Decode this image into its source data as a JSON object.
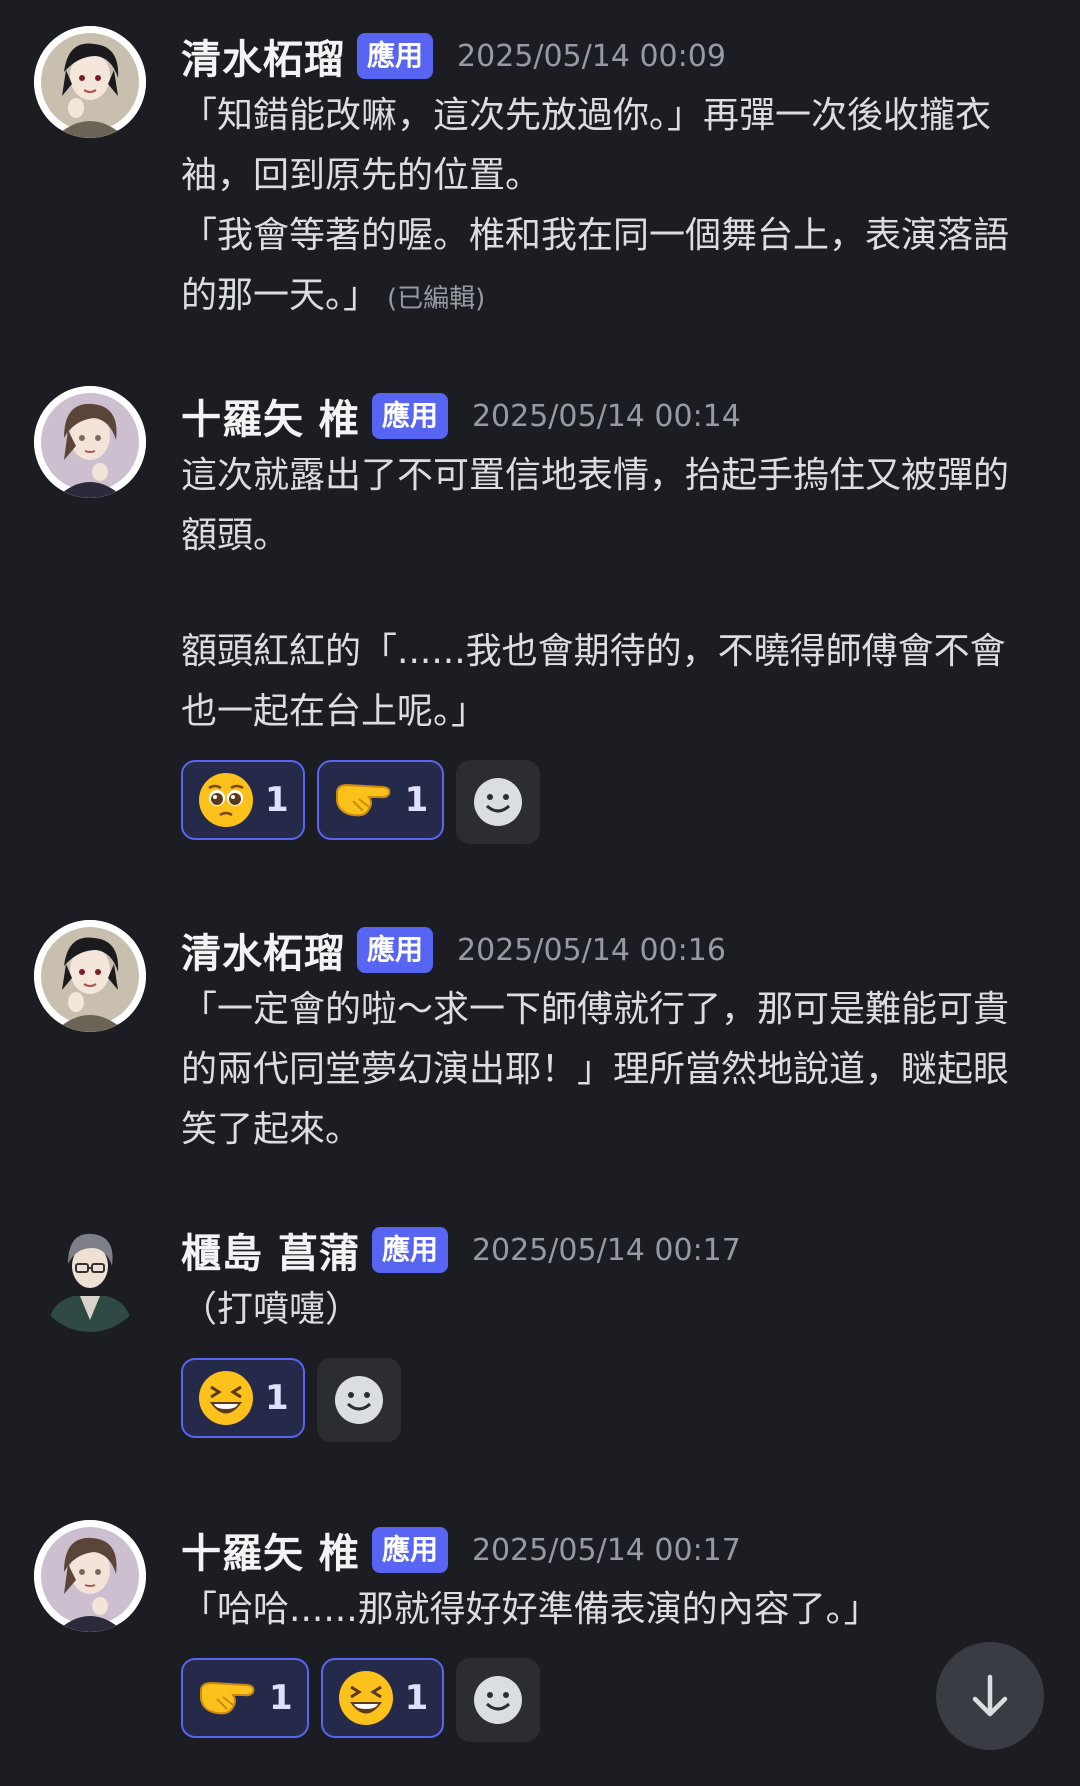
{
  "messages": [
    {
      "author": "清水柘瑠",
      "badge": "應用",
      "timestamp": "2025/05/14 00:09",
      "lines": [
        "「知錯能改嘛，這次先放過你。」再彈一次後收攏衣",
        "袖，回到原先的位置。",
        "「我會等著的喔。椎和我在同一個舞台上，表演落語",
        "的那一天。」"
      ],
      "edited": "(已編輯)"
    },
    {
      "author": "十羅矢 椎",
      "badge": "應用",
      "timestamp": "2025/05/14 00:14",
      "lines": [
        "這次就露出了不可置信地表情，抬起手摀住又被彈的",
        "額頭。",
        "",
        "額頭紅紅的「......我也會期待的，不曉得師傅會不會",
        "也一起在台上呢。」"
      ],
      "reactions": [
        {
          "emoji": "pleading-face",
          "count": "1"
        },
        {
          "emoji": "pointing-hand",
          "count": "1"
        }
      ]
    },
    {
      "author": "清水柘瑠",
      "badge": "應用",
      "timestamp": "2025/05/14 00:16",
      "lines": [
        "「一定會的啦〜求一下師傅就行了，那可是難能可貴",
        "的兩代同堂夢幻演出耶！」理所當然地說道，瞇起眼",
        "笑了起來。"
      ]
    },
    {
      "author": "櫃島 菖蒲",
      "badge": "應用",
      "timestamp": "2025/05/14 00:17",
      "lines": [
        "（打噴嚏）"
      ],
      "reactions": [
        {
          "emoji": "laughing-face",
          "count": "1"
        }
      ]
    },
    {
      "author": "十羅矢 椎",
      "badge": "應用",
      "timestamp": "2025/05/14 00:17",
      "lines": [
        "「哈哈......那就得好好準備表演的內容了。」"
      ],
      "reactions": [
        {
          "emoji": "pointing-hand",
          "count": "1"
        },
        {
          "emoji": "laughing-face",
          "count": "1"
        }
      ]
    }
  ],
  "icons": {
    "add_reaction": "smiley-add-icon",
    "scroll_down": "arrow-down-icon"
  },
  "colors": {
    "background": "#1c1d22",
    "badge": "#5865f2",
    "reaction_border": "#5865f2",
    "reaction_bg": "#262a4a"
  }
}
